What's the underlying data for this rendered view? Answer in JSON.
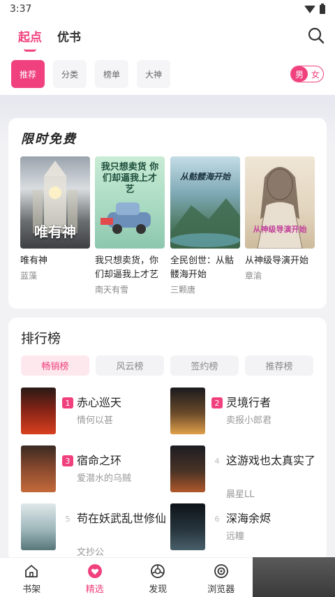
{
  "status_bar": {
    "time": "3:37"
  },
  "top_nav": {
    "tabs": [
      {
        "label": "起点"
      },
      {
        "label": "优书"
      }
    ]
  },
  "categories": {
    "items": [
      {
        "label": "推荐"
      },
      {
        "label": "分类"
      },
      {
        "label": "榜单"
      },
      {
        "label": "大神"
      }
    ],
    "gender": {
      "male": "男",
      "female": "女"
    }
  },
  "free_section": {
    "title": "限时免费",
    "books": [
      {
        "title": "唯有神",
        "author": "蓝藻",
        "cover_text": "唯有神"
      },
      {
        "title": "我只想卖货，你们却逼我上才艺",
        "author": "南天有雪",
        "cover_text": "我只想卖货 你们却逼我上才艺"
      },
      {
        "title": "全民创世：从骷髅海开始",
        "author": "三颗唐",
        "cover_text": "从骷髅海开始"
      },
      {
        "title": "从神级导演开始",
        "author": "章渝",
        "cover_text": "从神级导演开始"
      }
    ]
  },
  "ranking": {
    "title": "排行榜",
    "tabs": [
      {
        "label": "畅销榜"
      },
      {
        "label": "风云榜"
      },
      {
        "label": "签约榜"
      },
      {
        "label": "推荐榜"
      }
    ],
    "items": [
      {
        "rank": "1",
        "title": "赤心巡天",
        "author": "情何以甚"
      },
      {
        "rank": "2",
        "title": "灵境行者",
        "author": "卖报小郎君"
      },
      {
        "rank": "3",
        "title": "宿命之环",
        "author": "爱潜水的乌贼"
      },
      {
        "rank": "4",
        "title": "这游戏也太真实了",
        "author": "晨星LL"
      },
      {
        "rank": "5",
        "title": "苟在妖武乱世修仙",
        "author": "文抄公"
      },
      {
        "rank": "6",
        "title": "深海余烬",
        "author": "远瞳"
      }
    ]
  },
  "bottom_nav": {
    "tabs": [
      {
        "label": "书架"
      },
      {
        "label": "精选"
      },
      {
        "label": "发现"
      },
      {
        "label": "浏览器"
      }
    ]
  },
  "colors": {
    "accent": "#f0407d",
    "background": "#f2f2f5"
  }
}
